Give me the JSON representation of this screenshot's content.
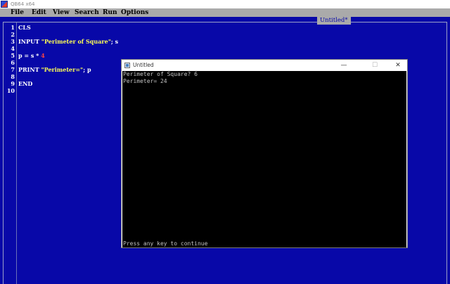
{
  "window": {
    "title": "QB64 x64"
  },
  "menu": [
    "File",
    "Edit",
    "View",
    "Search",
    "Run",
    "Options"
  ],
  "editor": {
    "document_title": "Untitled*",
    "line_numbers": [
      "1",
      "2",
      "3",
      "4",
      "5",
      "6",
      "7",
      "8",
      "9",
      "10"
    ],
    "lines": [
      [
        {
          "t": "CLS",
          "c": "kw"
        }
      ],
      [],
      [
        {
          "t": "INPUT ",
          "c": "kw"
        },
        {
          "t": "\"Perimeter of Square\"",
          "c": "str"
        },
        {
          "t": "; s",
          "c": "op"
        }
      ],
      [],
      [
        {
          "t": "p = s * ",
          "c": "op"
        },
        {
          "t": "4",
          "c": "num"
        }
      ],
      [],
      [
        {
          "t": "PRINT ",
          "c": "kw"
        },
        {
          "t": "\"Perimeter=\"",
          "c": "str"
        },
        {
          "t": "; p",
          "c": "op"
        }
      ],
      [],
      [
        {
          "t": "END",
          "c": "kw"
        }
      ],
      []
    ]
  },
  "console": {
    "title": "Untitled",
    "controls": {
      "minimize": "—",
      "maximize": "☐",
      "close": "✕"
    },
    "output": [
      "Perimeter of Square? 6",
      "Perimeter= 24"
    ],
    "prompt": "Press any key to continue"
  },
  "colors": {
    "ide_background": "#0808a8",
    "keyword": "#ffffff",
    "string": "#ffff55",
    "number": "#ff4444",
    "menu_background": "#aaaaaa"
  }
}
